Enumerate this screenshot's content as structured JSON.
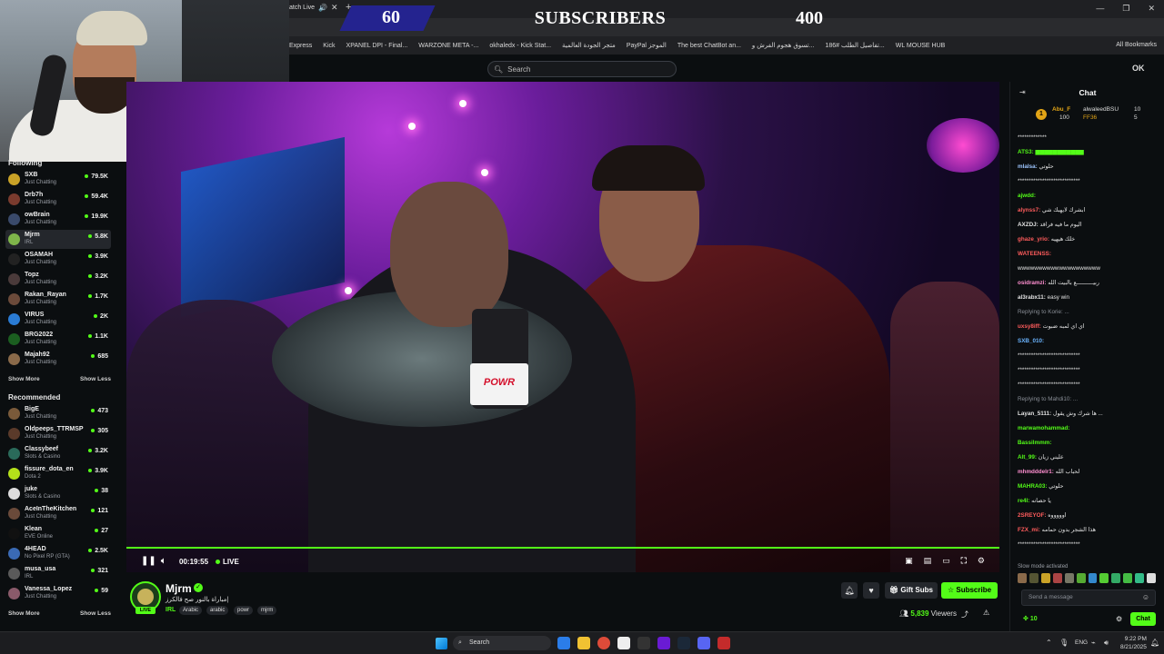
{
  "banner": {
    "left_count": "60",
    "title": "SUBSCRIBERS",
    "right_count": "400"
  },
  "browser": {
    "tab_title": "atch Live",
    "bookmarks": [
      "Express",
      "Kick",
      "XPANEL DPI - Final...",
      "WARZONE META -...",
      "okhaledx - Kick Stat...",
      "متجر الجودة العالمية",
      "PayPal الموجز",
      "The best ChatBot an...",
      "تسوق هجوم الفرش و...",
      "تفاصيل الطلب #186...",
      "WL MOUSE HUB"
    ],
    "all_bookmarks": "All Bookmarks"
  },
  "header": {
    "search_placeholder": "Search"
  },
  "sidebar": {
    "following_label": "Following",
    "following": [
      {
        "name": "SXB",
        "category": "Just Chatting",
        "viewers": "79.5K",
        "color": "#c9a227"
      },
      {
        "name": "Drb7h",
        "category": "Just Chatting",
        "viewers": "59.4K",
        "color": "#7a3b2e"
      },
      {
        "name": "owBrain",
        "category": "Just Chatting",
        "viewers": "19.9K",
        "color": "#3a4a6b"
      },
      {
        "name": "Mjrm",
        "category": "IRL",
        "viewers": "5.8K",
        "color": "#7fb54a"
      },
      {
        "name": "OSAMAH",
        "category": "Just Chatting",
        "viewers": "3.9K",
        "color": "#222"
      },
      {
        "name": "Topz",
        "category": "Just Chatting",
        "viewers": "3.2K",
        "color": "#4a3a3a"
      },
      {
        "name": "Rakan_Rayan",
        "category": "Just Chatting",
        "viewers": "1.7K",
        "color": "#6b4a3a"
      },
      {
        "name": "VIRUS",
        "category": "Just Chatting",
        "viewers": "2K",
        "color": "#2a7bd4"
      },
      {
        "name": "BRG2022",
        "category": "Just Chatting",
        "viewers": "1.1K",
        "color": "#1b5e20"
      },
      {
        "name": "Majah92",
        "category": "Just Chatting",
        "viewers": "685",
        "color": "#8a6a4a"
      }
    ],
    "show_more": "Show More",
    "show_less": "Show Less",
    "recommended_label": "Recommended",
    "recommended": [
      {
        "name": "BigE",
        "category": "Just Chatting",
        "viewers": "473",
        "color": "#7a5a3a"
      },
      {
        "name": "Oldpeeps_TTRMSP",
        "category": "Just Chatting",
        "viewers": "305",
        "color": "#5a3a2a"
      },
      {
        "name": "Classybeef",
        "category": "Slots & Casino",
        "viewers": "3.2K",
        "color": "#2a6a5a"
      },
      {
        "name": "fissure_dota_en",
        "category": "Dota 2",
        "viewers": "3.9K",
        "color": "#b4e01a"
      },
      {
        "name": "juke",
        "category": "Slots & Casino",
        "viewers": "38",
        "color": "#ddd"
      },
      {
        "name": "AceInTheKitchen",
        "category": "Just Chatting",
        "viewers": "121",
        "color": "#6a4a3a"
      },
      {
        "name": "Klean",
        "category": "EVE Online",
        "viewers": "27",
        "color": "#111"
      },
      {
        "name": "4HEAD",
        "category": "No Pixel RP (GTA)",
        "viewers": "2.5K",
        "color": "#3a6ab4"
      },
      {
        "name": "musa_usa",
        "category": "IRL",
        "viewers": "321",
        "color": "#5a5a5a"
      },
      {
        "name": "Vanessa_Lopez",
        "category": "Just Chatting",
        "viewers": "59",
        "color": "#8a5a6a"
      }
    ]
  },
  "player": {
    "time": "00:19:55",
    "live": "LIVE",
    "progress": 1.0
  },
  "stream": {
    "streamer": "Mjrm",
    "live_badge": "LIVE",
    "title": "مباراة بالنور صح فالكرز|",
    "category": "IRL",
    "tags": [
      "Arabic",
      "arabic",
      "powr",
      "mjrm"
    ],
    "gift_label": "Gift Subs",
    "subscribe_label": "Subscribe",
    "viewers": "5,839",
    "viewers_label": "Viewers"
  },
  "chat": {
    "title": "Chat",
    "leaders": [
      {
        "name": "Abu_F",
        "value": "100"
      },
      {
        "name": "alwaleedBSU",
        "value": "10"
      },
      {
        "name": "FF36",
        "value": "5"
      }
    ],
    "messages": [
      {
        "user": "",
        "text": "*************",
        "color": "#e4e4e4"
      },
      {
        "user": "ATS3:",
        "text": "▆▆▆▆▆▆▆▆▆▆▆",
        "color": "#53fc18"
      },
      {
        "user": "mlalsa:",
        "text": "حلوتي",
        "color": "#9ec6ff"
      },
      {
        "user": "",
        "text": "****************************",
        "color": "#e4e4e4"
      },
      {
        "user": "ajwdd:",
        "text": "",
        "color": "#53fc18"
      },
      {
        "user": "alynss7:",
        "text": "ابشرك لايهبك شي",
        "color": "#ff5c5c"
      },
      {
        "user": "AXZDJ:",
        "text": "اليوم ما فيه فراقد",
        "color": "#e4e4e4"
      },
      {
        "user": "ghaze_yrio:",
        "text": "خلك هيهيه",
        "color": "#ff5c5c"
      },
      {
        "user": "WATEENSS:",
        "text": "",
        "color": "#ff5c5c"
      },
      {
        "user": "",
        "text": "wwwwwwwwwwwwwwwwwwww",
        "color": "#e4e4e4"
      },
      {
        "user": "osidramzi:",
        "text": "ربيــــــــــع بالبيت الله",
        "color": "#ff8fd1"
      },
      {
        "user": "al3rabx11:",
        "text": "easy win",
        "color": "#e4e4e4"
      },
      {
        "user": "",
        "text": "Replying to Korie: ...",
        "color": "#8a8f97"
      },
      {
        "user": "uxsy8iff:",
        "text": "اي اي لمبه ضبوت",
        "color": "#ff5c5c"
      },
      {
        "user": "SXB_010:",
        "text": "",
        "color": "#6ab4ff"
      },
      {
        "user": "",
        "text": "****************************",
        "color": "#e4e4e4"
      },
      {
        "user": "",
        "text": "****************************",
        "color": "#e4e4e4"
      },
      {
        "user": "",
        "text": "****************************",
        "color": "#e4e4e4"
      },
      {
        "user": "",
        "text": "Replying to Mahdi10: ...",
        "color": "#8a8f97"
      },
      {
        "user": "Layan_5111:",
        "text": "ها شرك وش يقول ...",
        "color": "#e4e4e4"
      },
      {
        "user": "marwamohammad:",
        "text": "",
        "color": "#53fc18"
      },
      {
        "user": "Bassilmmm:",
        "text": "",
        "color": "#53fc18"
      },
      {
        "user": "Alt_99:",
        "text": "عليني زيان",
        "color": "#53fc18"
      },
      {
        "user": "mhmdddelr1:",
        "text": "لحباب الله",
        "color": "#ff8fd1"
      },
      {
        "user": "MAHRA03:",
        "text": "حلوتي",
        "color": "#53fc18"
      },
      {
        "user": "re4l:",
        "text": "يا حصانه",
        "color": "#53fc18"
      },
      {
        "user": "2SREYOF:",
        "text": "اوووووه",
        "color": "#ff5c5c"
      },
      {
        "user": "FZX_mi:",
        "text": "هذا الشجر بدون حمامه",
        "color": "#ff5c5c"
      },
      {
        "user": "",
        "text": "****************************",
        "color": "#e4e4e4"
      }
    ],
    "slow_mode": "Slow mode activated",
    "input_placeholder": "Send a message",
    "points": "10",
    "send_label": "Chat"
  },
  "taskbar": {
    "search_placeholder": "Search",
    "lang": "ENG",
    "time": "9:22 PM",
    "date": "8/21/2025"
  }
}
